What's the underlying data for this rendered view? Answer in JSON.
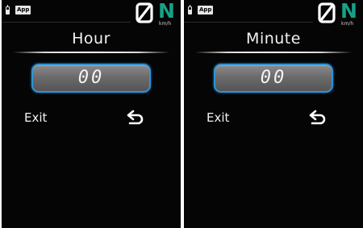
{
  "screens": [
    {
      "status": {
        "app_badge": "App",
        "gear": "N",
        "speed_unit": "km/h",
        "speed_icon": "zero-slash-digit"
      },
      "title": "Hour",
      "value": "00",
      "exit_label": "Exit",
      "back_icon": "return-arrow-icon"
    },
    {
      "status": {
        "app_badge": "App",
        "gear": "N",
        "speed_unit": "km/h",
        "speed_icon": "zero-slash-digit"
      },
      "title": "Minute",
      "value": "00",
      "exit_label": "Exit",
      "back_icon": "return-arrow-icon"
    }
  ],
  "colors": {
    "background": "#050505",
    "gear_accent": "#16a188",
    "value_border": "#2f93d6",
    "text": "#f2f2f2"
  }
}
